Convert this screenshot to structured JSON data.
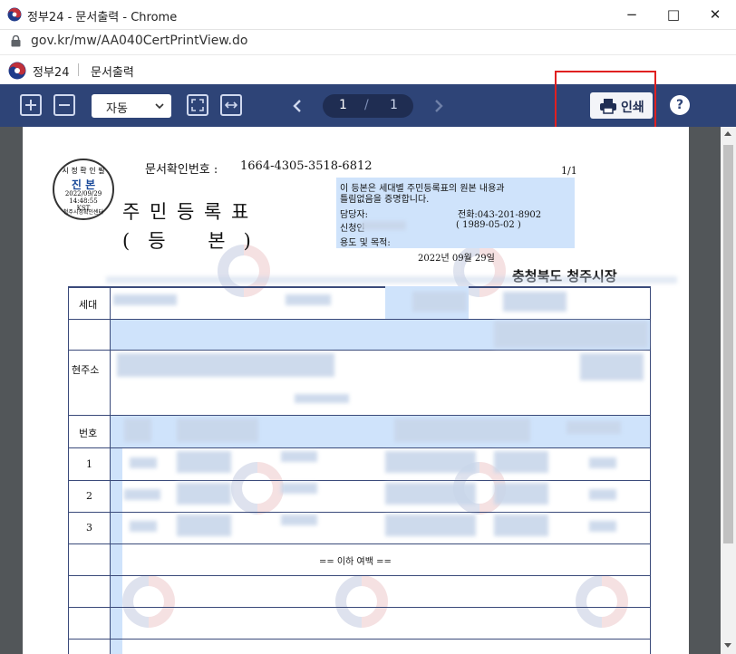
{
  "window": {
    "title": "정부24 - 문서출력 - Chrome",
    "url": "gov.kr/mw/AA040CertPrintView.do",
    "controls": {
      "minimize": "−",
      "maximize": "□",
      "close": "✕"
    }
  },
  "site": {
    "brand": "정부24",
    "section": "문서출력"
  },
  "toolbar": {
    "zoom_in": "+",
    "zoom_out": "−",
    "zoom_mode": "자동",
    "page_current": "1",
    "page_separator": "/",
    "page_total": "1",
    "print_label": "인쇄",
    "help_label": "?",
    "icons": [
      "plus-icon",
      "minus-icon",
      "fit-page-icon",
      "fit-width-icon",
      "prev-page-icon",
      "next-page-icon",
      "printer-icon",
      "help-icon"
    ]
  },
  "document": {
    "doc_number_label": "문서확인번호 :",
    "doc_number": "1664-4305-3518-6812",
    "page_indicator": "1/1",
    "title": "주 민 등 록 표",
    "subtitle": "(   등       본   )",
    "seal": {
      "top": "시 정 확 인 필",
      "middle": "진 본",
      "date": "2022/09/29",
      "time": "14:48:55",
      "zone": "KST",
      "bottom": "청주시정확인센터"
    },
    "notice_line1": "이 등본은 세대별 주민등록표의 원본 내용과",
    "notice_line2": "틀림없음을 증명합니다.",
    "officer_label": "담당자:",
    "phone": "전화:043-201-8902",
    "applicant_label": "신청인",
    "applicant_birth": "( 1989-05-02 )",
    "purpose_label": "용도 및 목적:",
    "issue_date": "2022년 09월 29일",
    "issuer": "충청북도 청주시장",
    "row_labels": {
      "household": "세대",
      "address": "현주소",
      "number": "번호"
    },
    "rows": [
      "1",
      "2",
      "3"
    ],
    "end_mark": "== 이하 여백 =="
  },
  "colors": {
    "toolbar_bg": "#2e4477",
    "highlight": "#e02020",
    "field_blue": "#cfe3fb"
  }
}
